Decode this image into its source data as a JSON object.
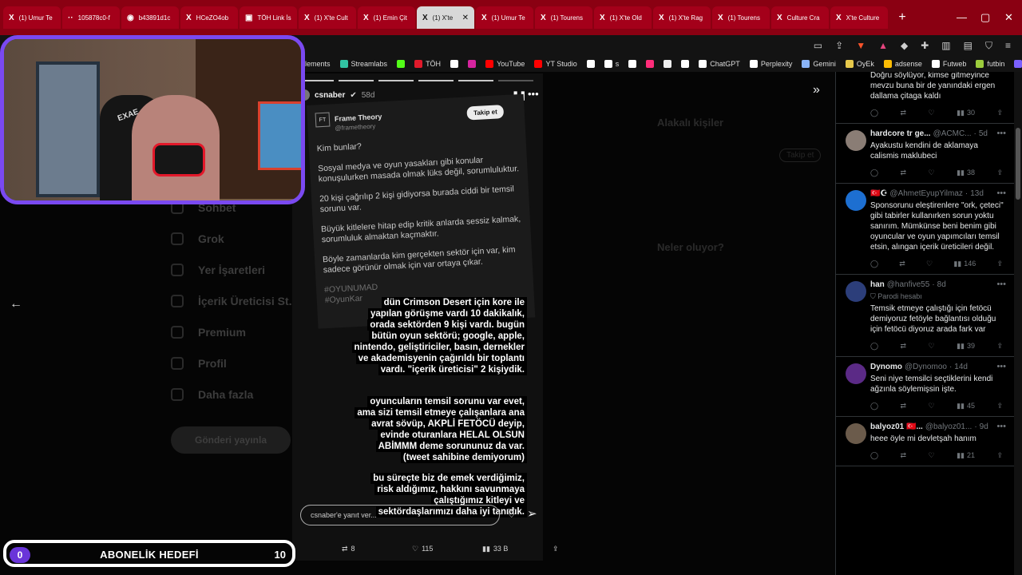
{
  "tabs": [
    {
      "icon": "X",
      "label": "(1) Umur Te",
      "active": false
    },
    {
      "icon": "··",
      "label": "105878c0-f",
      "active": false
    },
    {
      "icon": "◉",
      "label": "b43891d1c",
      "active": false
    },
    {
      "icon": "X",
      "label": "HCeZO4ob",
      "active": false
    },
    {
      "icon": "▣",
      "label": "TÖH Link İs",
      "active": false
    },
    {
      "icon": "X",
      "label": "(1) X'te Cult",
      "active": false
    },
    {
      "icon": "X",
      "label": "(1) Emin Çit",
      "active": false
    },
    {
      "icon": "X",
      "label": "(1) X'te",
      "active": true
    },
    {
      "icon": "X",
      "label": "(1) Umur Te",
      "active": false
    },
    {
      "icon": "X",
      "label": "(1) Tourens",
      "active": false
    },
    {
      "icon": "X",
      "label": "(1) X'te Old",
      "active": false
    },
    {
      "icon": "X",
      "label": "(1) X'te Rag",
      "active": false
    },
    {
      "icon": "X",
      "label": "(1) Tourens",
      "active": false
    },
    {
      "icon": "X",
      "label": "Culture Cra",
      "active": false
    },
    {
      "icon": "X",
      "label": "X'te Culture",
      "active": false
    }
  ],
  "new_tab": "+",
  "bookmarks": [
    {
      "label": "Elements",
      "color": ""
    },
    {
      "label": "Streamlabs",
      "color": "#31c3a2"
    },
    {
      "label": "",
      "color": "#53fc18"
    },
    {
      "label": "TÖH",
      "color": "#e01a2b"
    },
    {
      "label": "",
      "color": "#ffffff"
    },
    {
      "label": "",
      "color": "#d6249f"
    },
    {
      "label": "YouTube",
      "color": "#ff0000"
    },
    {
      "label": "YT Studio",
      "color": "#ff0000"
    },
    {
      "label": "",
      "color": "#ffffff"
    },
    {
      "label": "s",
      "color": "#ffffff"
    },
    {
      "label": "",
      "color": "#ffffff"
    },
    {
      "label": "",
      "color": "#ff2d7a"
    },
    {
      "label": "",
      "color": "#eeeeee"
    },
    {
      "label": "",
      "color": "#ffffff"
    },
    {
      "label": "ChatGPT",
      "color": "#ffffff"
    },
    {
      "label": "Perplexity",
      "color": "#ffffff"
    },
    {
      "label": "Gemini",
      "color": "#8ab4f8"
    },
    {
      "label": "OyEk",
      "color": "#e6c84b"
    },
    {
      "label": "adsense",
      "color": "#fbbc04"
    },
    {
      "label": "Futweb",
      "color": "#ffffff"
    },
    {
      "label": "futbin",
      "color": "#9ccc3c"
    },
    {
      "label": "",
      "color": "#7b61ff"
    }
  ],
  "story": {
    "username": "csnaber",
    "age": "58d",
    "tweet_author": "Frame Theory",
    "tweet_handle": "@frametheory",
    "follow_label": "Takip et",
    "tweet_paragraphs": [
      "Kim bunlar?",
      "Sosyal medya ve oyun yasakları gibi konular konuşulurken masada olmak lüks değil, sorumluluktur.",
      "20 kişi çağrılıp 2 kişi gidiyorsa burada ciddi bir temsil sorunu var.",
      "Büyük kitlelere hitap edip kritik anlarda sessiz kalmak, sorumluluk almaktan kaçmaktır.",
      "Böyle zamanlarda kim gerçekten sektör için var, kim sadece görünür olmak için var ortaya çıkar.",
      "#OYUNUMAD",
      "#OyunKar"
    ],
    "overlay_1": "dün Crimson Desert için kore ile yapılan görüşme vardı 10 dakikalık, orada sektörden 9 kişi vardı. bugün bütün oyun sektörü; google, apple, nintendo, geliştiriciler, basın, dernekler ve akademisyenin çağırıldı bir toplantı vardı. \"içerik üreticisi\" 2 kişiydik.",
    "overlay_2": "oyuncuların temsil sorunu var evet, ama sizi temsil etmeye çalışanlara ana avrat sövüp, AKPLİ FETÖCÜ deyip, evinde oturanlara HELAL OLSUN ABİMMM deme sorununuz da var. (tweet sahibine demiyorum)",
    "overlay_3": "bu süreçte biz de emek verdiğimiz, risk aldığımız, hakkını savunmaya çalıştığımız kitleyi ve sektördaşlarımızı daha iyi tanıdık.",
    "reply_placeholder": "csnaber'e yanıt ver..."
  },
  "post_stats": {
    "retweets": "8",
    "likes": "115",
    "views": "33 B"
  },
  "left_nav": [
    "Sohbet",
    "Grok",
    "Yer İşaretleri",
    "İçerik Üreticisi St...",
    "Premium",
    "Profil",
    "Daha fazla"
  ],
  "post_button": "Gönderi yayınla",
  "sidebar_ghost": {
    "who_to_follow": "Alakalı kişiler",
    "whats_happening": "Neler oluyor?",
    "follow": "Takip et"
  },
  "webcam": {
    "chair_text": "EXAE"
  },
  "sub_goal": {
    "current": "0",
    "title": "ABONELİK HEDEFİ",
    "target": "10"
  },
  "replies": [
    {
      "name": "",
      "handle": "",
      "time": "",
      "badge": "",
      "text": "Doğru söylüyor, kimse gitmeyince mevzu buna bir de yanındaki ergen dallama çitaga kaldı",
      "replies": "",
      "retweets": "",
      "likes": "",
      "views": "30",
      "avatar_color": "#000000",
      "partial": true
    },
    {
      "name": "hardcore tr ge...",
      "handle": "@ACMC...",
      "time": "5d",
      "badge": "",
      "text": "Ayakustu kendini de aklamaya calismis maklubeci",
      "replies": "",
      "retweets": "",
      "likes": "",
      "views": "38",
      "avatar_color": "#8a7d75",
      "partial": false
    },
    {
      "name": "🇹🇷☪",
      "handle": "@AhmetEyupYilmaz",
      "time": "13d",
      "badge": "",
      "text": "Sponsorunu eleştirenlere \"ork, çeteci\" gibi tabirler kullanırken sorun yoktu sanırım. Mümkünse beni benim gibi oyuncular ve oyun yapımcıları temsil etsin, alıngan içerik üreticileri değil.",
      "replies": "",
      "retweets": "",
      "likes": "",
      "views": "146",
      "avatar_color": "#1d6fd1",
      "partial": false
    },
    {
      "name": "han",
      "handle": "@hanfive55",
      "time": "8d",
      "badge": "Parodi hesabı",
      "text": "Temsik etmeye çalıştığı için fetöcü demiyoruz fetöyle bağlantısı olduğu için fetöcü diyoruz arada fark var",
      "replies": "",
      "retweets": "",
      "likes": "",
      "views": "39",
      "avatar_color": "#2c3e7a",
      "partial": false
    },
    {
      "name": "Dynomo",
      "handle": "@Dynomoo",
      "time": "14d",
      "badge": "",
      "text": "Seni niye temsilci seçtiklerini kendi ağzınla söylemişsin işte.",
      "replies": "",
      "retweets": "",
      "likes": "",
      "views": "45",
      "avatar_color": "#5b2a86",
      "partial": false
    },
    {
      "name": "balyoz01 🇹🇷...",
      "handle": "@balyoz01...",
      "time": "9d",
      "badge": "",
      "text": "heee öyle mi devletşah hanım",
      "replies": "",
      "retweets": "",
      "likes": "",
      "views": "21",
      "avatar_color": "#6b5b4b",
      "partial": false
    }
  ]
}
